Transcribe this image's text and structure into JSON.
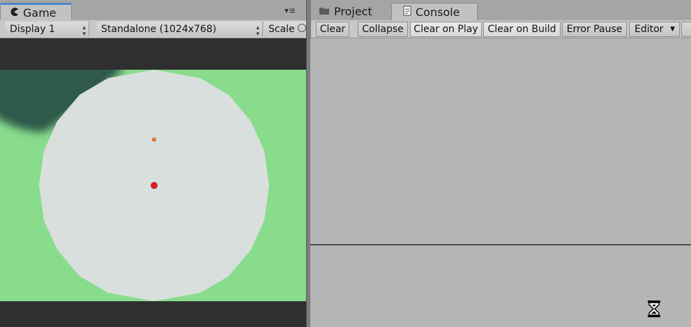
{
  "game_panel": {
    "tab_label": "Game",
    "tab_icon": "pacman-icon",
    "menu_icon": "▾≡",
    "display_select": "Display 1",
    "resolution_select": "Standalone (1024x768)",
    "scale_label": "Scale"
  },
  "console_panel": {
    "tabs": [
      {
        "label": "Project",
        "icon": "folder-icon"
      },
      {
        "label": "Console",
        "icon": "console-icon"
      }
    ],
    "buttons": {
      "clear": "Clear",
      "collapse": "Collapse",
      "clear_on_play": "Clear on Play",
      "clear_on_build": "Clear on Build",
      "error_pause": "Error Pause",
      "editor": "Editor"
    },
    "busy_icon": "hourglass-icon"
  },
  "colors": {
    "field_green": "#88dc8c",
    "shadow_green": "#2f5a4b",
    "disc": "#d8dfdc",
    "red_dot": "#cf2525",
    "orange_dot": "#e0641e",
    "letterbox": "#2f2f2f"
  }
}
